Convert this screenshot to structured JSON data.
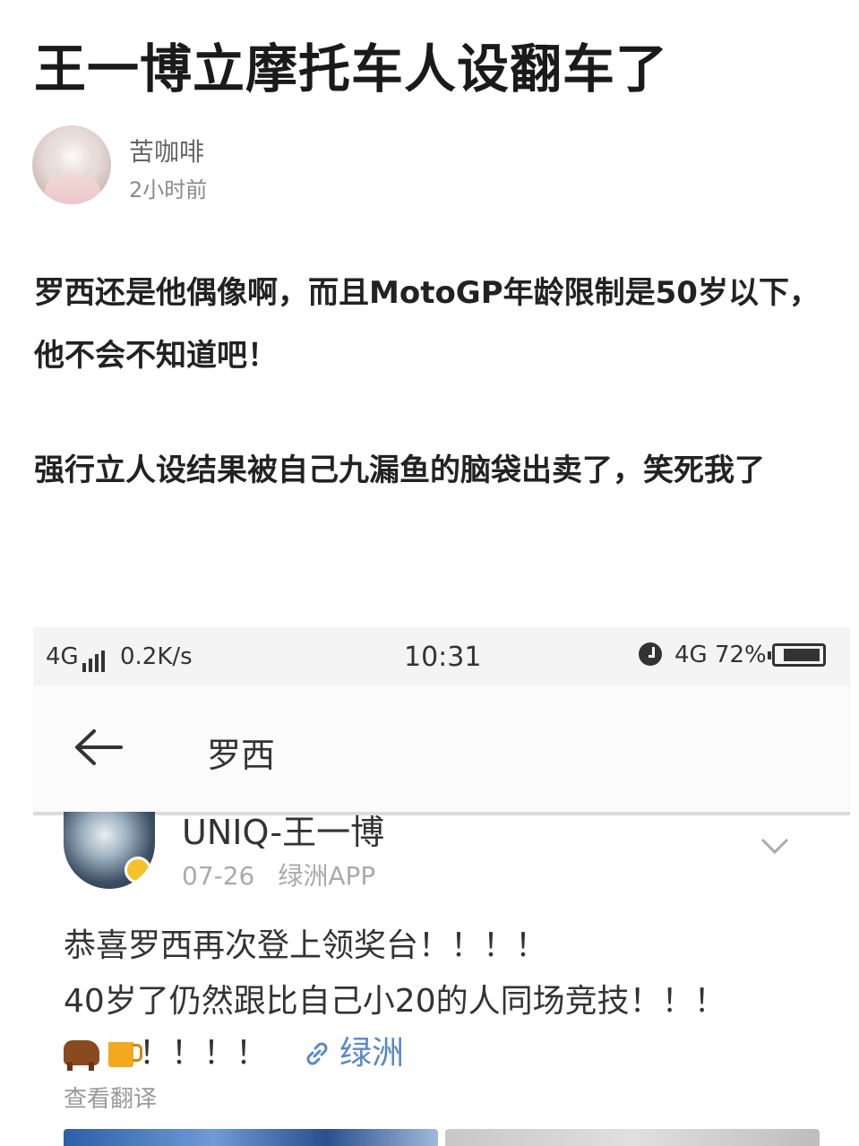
{
  "article": {
    "title": "王一博立摩托车人设翻车了",
    "author": {
      "name": "苦咖啡",
      "time": "2小时前"
    },
    "paragraphs": [
      "罗西还是他偶像啊，而且MotoGP年龄限制是50岁以下，他不会不知道吧！",
      "强行立人设结果被自己九漏鱼的脑袋出卖了，笑死我了"
    ]
  },
  "screenshot": {
    "statusbar": {
      "network": "4G",
      "speed": "0.2K/s",
      "time": "10:31",
      "network_right": "4G",
      "battery": "72%"
    },
    "nav": {
      "title": "罗西"
    },
    "post": {
      "user": "UNIQ-王一博",
      "date": "07-26",
      "source": "绿洲APP",
      "lines": [
        "恭喜罗西再次登上领奖台！！！！",
        "40岁了仍然跟比自己小20的人同场竞技！！！",
        "！！！！"
      ],
      "link": "绿洲",
      "translate": "查看翻译"
    }
  },
  "icons": [
    "back-arrow-icon",
    "chevron-down-icon",
    "link-icon",
    "alarm-icon",
    "battery-icon",
    "signal-icon",
    "cow-emoji-icon",
    "beer-emoji-icon",
    "verified-badge-icon"
  ]
}
